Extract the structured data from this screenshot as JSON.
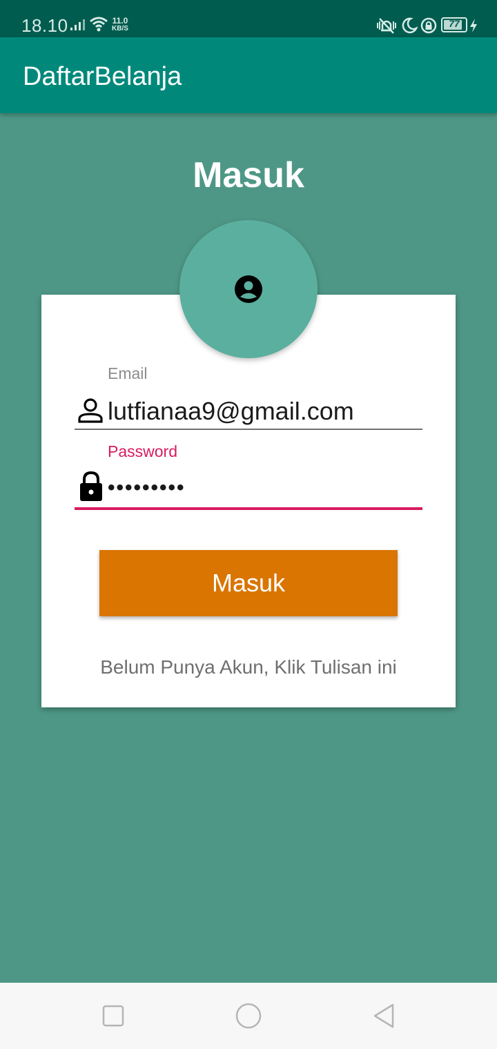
{
  "status_bar": {
    "time": "18.10",
    "net_speed_value": "11.0",
    "net_speed_unit": "KB/S",
    "battery_level": "77",
    "icons": [
      "signal-icon",
      "wifi-icon",
      "vibrate-icon",
      "moon-icon",
      "lock-rotate-icon",
      "battery-icon",
      "charging-icon"
    ]
  },
  "app_bar": {
    "title": "DaftarBelanja"
  },
  "login": {
    "title": "Masuk",
    "avatar_icon": "account-circle-icon",
    "email": {
      "label": "Email",
      "value": "lutfianaa9@gmail.com",
      "icon": "person-icon"
    },
    "password": {
      "label": "Password",
      "value": "•••••••••",
      "icon": "lock-icon"
    },
    "submit_label": "Masuk",
    "register_text": "Belum Punya Akun, Klik Tulisan ini"
  },
  "nav_bar": {
    "buttons": [
      "recents-icon",
      "home-icon",
      "back-icon"
    ]
  },
  "colors": {
    "background": "#4e9786",
    "app_bar": "#00897b",
    "status_bar": "#005c4f",
    "avatar": "#5baf9e",
    "button": "#d97500",
    "accent": "#d81b60"
  }
}
